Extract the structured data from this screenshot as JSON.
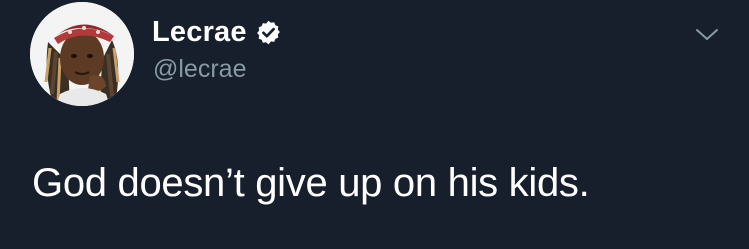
{
  "tweet": {
    "author": {
      "display_name": "Lecrae",
      "handle": "@lecrae",
      "verified": true,
      "avatar_icon": "profile-photo"
    },
    "text": "God doesn’t give up on his kids.",
    "menu_icon": "chevron-down-icon"
  },
  "colors": {
    "background": "#161f2b",
    "text": "#ffffff",
    "secondary_text": "#8899a6",
    "verified_badge": "#ffffff"
  }
}
